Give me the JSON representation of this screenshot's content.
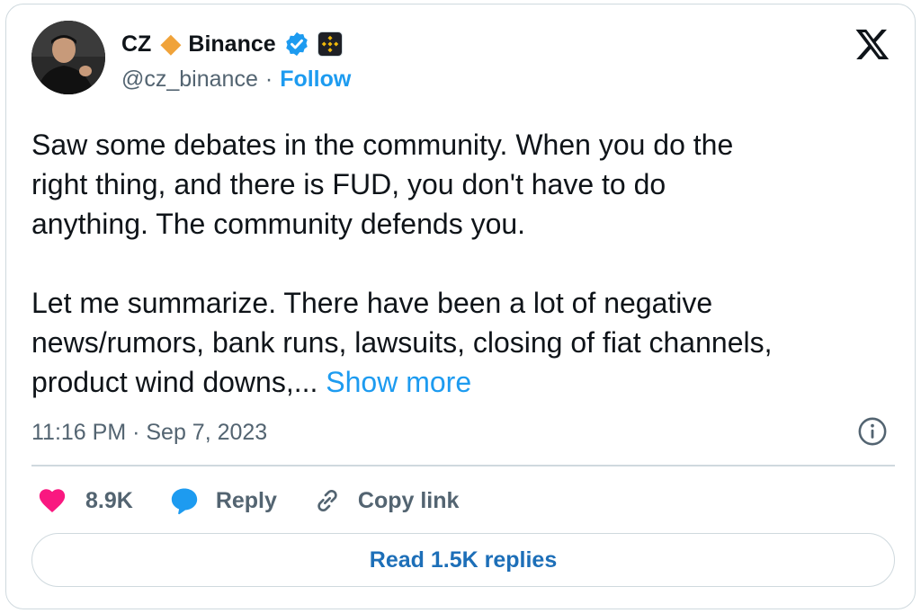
{
  "author": {
    "name": "CZ",
    "org_name": "Binance",
    "handle": "@cz_binance",
    "separator": "·",
    "follow_label": "Follow",
    "verified": true
  },
  "tweet": {
    "paragraphs": [
      [
        "Saw some debates in the community. When you do the",
        "right thing, and there is FUD, you don't have to do",
        "anything. The community defends you."
      ],
      [
        "Let me summarize. There have been a lot of negative",
        "news/rumors, bank runs, lawsuits, closing of fiat channels,",
        "product wind downs,..."
      ]
    ],
    "show_more_label": "Show more",
    "timestamp": "11:16 PM · Sep 7, 2023"
  },
  "actions": {
    "likes": "8.9K",
    "reply_label": "Reply",
    "copy_link_label": "Copy link"
  },
  "read_replies_label": "Read 1.5K replies",
  "colors": {
    "accent": "#1d9bf0",
    "like": "#f91880",
    "muted": "#536471",
    "border": "#cfd9de",
    "diamond": "#f0a33a"
  },
  "icons": {
    "logo": "x-logo-icon",
    "verified": "verified-badge-icon",
    "affiliate": "binance-logo-icon",
    "info": "info-icon",
    "like": "heart-icon",
    "reply": "speech-bubble-icon",
    "copy": "link-icon"
  }
}
